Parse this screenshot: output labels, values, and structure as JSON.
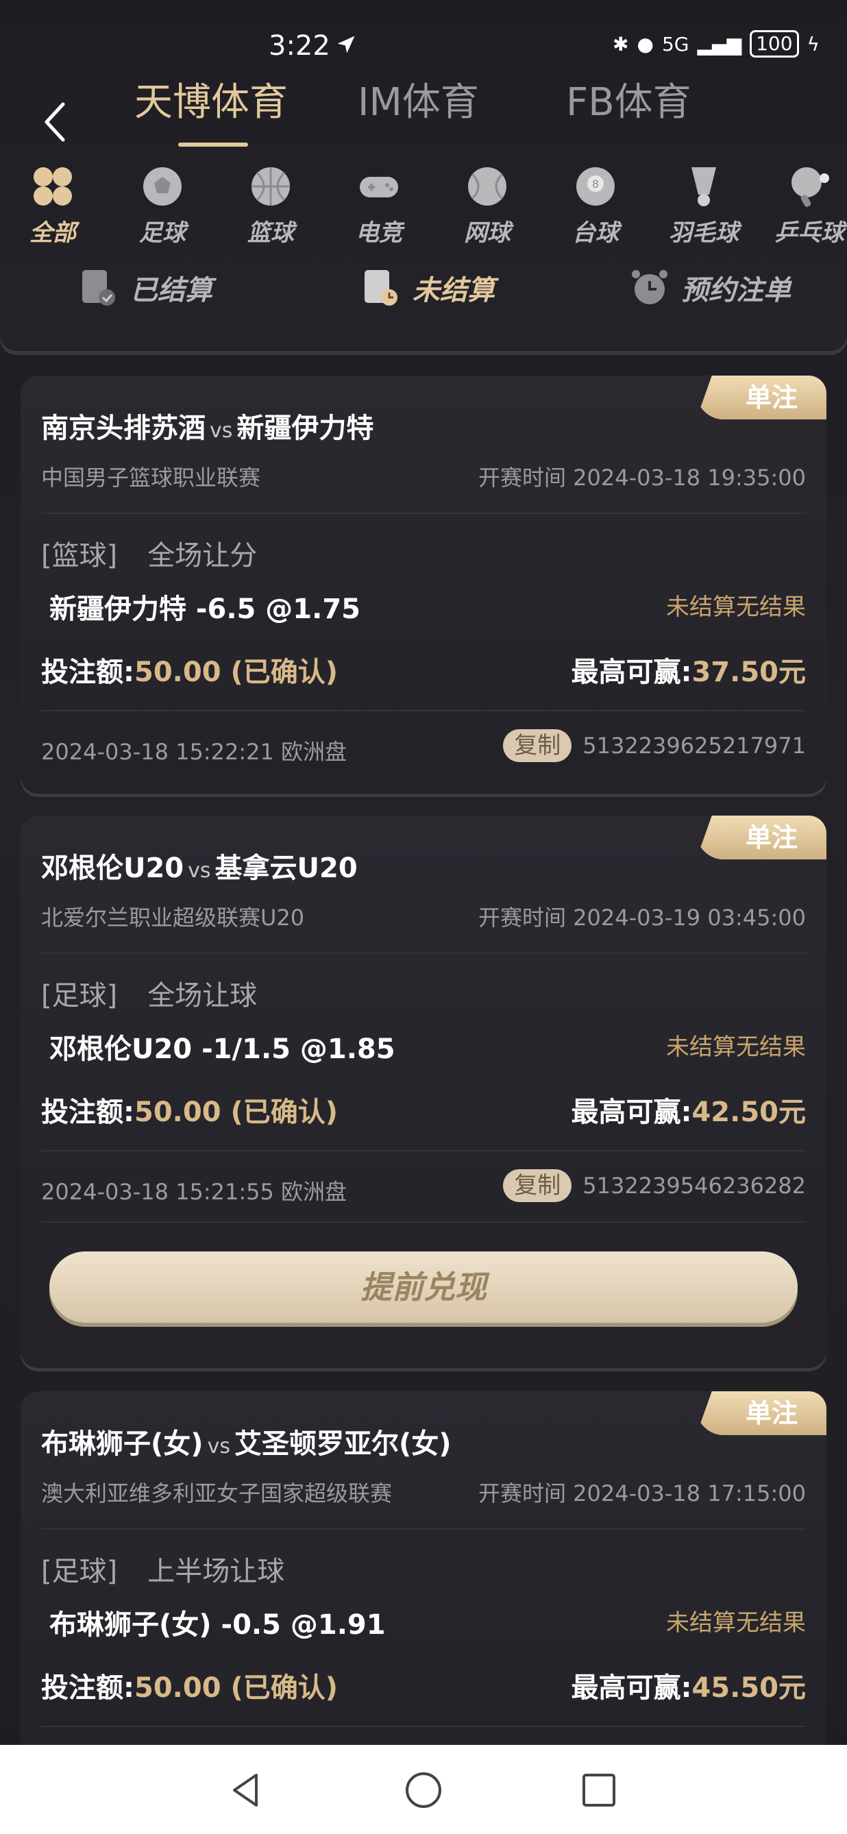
{
  "status": {
    "time": "3:22",
    "network": "5G",
    "battery": "100"
  },
  "header": {
    "tabs": [
      {
        "label": "天博体育",
        "active": true
      },
      {
        "label": "IM体育",
        "active": false
      },
      {
        "label": "FB体育",
        "active": false
      }
    ]
  },
  "sports": [
    {
      "label": "全部",
      "icon": "grid-icon",
      "active": true
    },
    {
      "label": "足球",
      "icon": "soccer-ball-icon"
    },
    {
      "label": "篮球",
      "icon": "basketball-icon"
    },
    {
      "label": "电竞",
      "icon": "gamepad-icon"
    },
    {
      "label": "网球",
      "icon": "tennis-ball-icon"
    },
    {
      "label": "台球",
      "icon": "billiard-ball-icon"
    },
    {
      "label": "羽毛球",
      "icon": "shuttlecock-icon"
    },
    {
      "label": "乒乓球",
      "icon": "ping-pong-icon"
    }
  ],
  "filters": [
    {
      "label": "已结算",
      "icon": "settled-doc-icon",
      "active": false
    },
    {
      "label": "未结算",
      "icon": "unsettled-doc-icon",
      "active": true
    },
    {
      "label": "预约注单",
      "icon": "alarm-clock-icon",
      "active": false
    }
  ],
  "bets": [
    {
      "badge": "单注",
      "home": "南京头排苏酒",
      "vs": "vs",
      "away": "新疆伊力特",
      "league": "中国男子篮球职业联赛",
      "start_time": "开赛时间 2024-03-18 19:35:00",
      "sport": "[篮球]",
      "play": "全场让分",
      "pick": "新疆伊力特  -6.5   @1.75",
      "result": "未结算无结果",
      "stake_label": "投注额:",
      "stake_value": "50.00 (已确认)",
      "maxwin_label": "最高可赢:",
      "maxwin_value": "37.50元",
      "bet_time": "2024-03-18 15:22:21 欧洲盘",
      "copy_label": "复制",
      "order_no": "5132239625217971"
    },
    {
      "badge": "单注",
      "home": "邓根伦U20",
      "vs": "vs",
      "away": "基拿云U20",
      "league": "北爱尔兰职业超级联赛U20",
      "start_time": "开赛时间 2024-03-19 03:45:00",
      "sport": "[足球]",
      "play": "全场让球",
      "pick": "邓根伦U20  -1/1.5   @1.85",
      "result": "未结算无结果",
      "stake_label": "投注额:",
      "stake_value": "50.00 (已确认)",
      "maxwin_label": "最高可赢:",
      "maxwin_value": "42.50元",
      "bet_time": "2024-03-18 15:21:55 欧洲盘",
      "copy_label": "复制",
      "order_no": "5132239546236282",
      "cashout_label": "提前兑现"
    },
    {
      "badge": "单注",
      "home": "布琳狮子(女)",
      "vs": "vs",
      "away": "艾圣顿罗亚尔(女)",
      "league": "澳大利亚维多利亚女子国家超级联赛",
      "start_time": "开赛时间 2024-03-18 17:15:00",
      "sport": "[足球]",
      "play": "上半场让球",
      "pick": "布琳狮子(女)  -0.5   @1.91",
      "result": "未结算无结果",
      "stake_label": "投注额:",
      "stake_value": "50.00 (已确认)",
      "maxwin_label": "最高可赢:",
      "maxwin_value": "45.50元"
    }
  ],
  "colors": {
    "gold": "#e2c89c",
    "accent_text": "#d8b988",
    "background": "#1d1c21"
  }
}
